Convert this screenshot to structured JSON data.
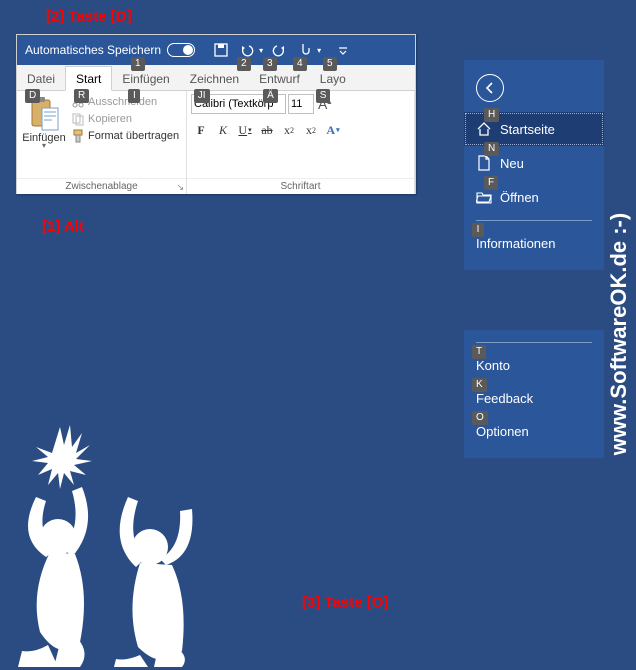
{
  "annotations": {
    "a1": "[1] Alt",
    "a2": "[2] Taste [D]",
    "a3": "[3] Taste [O]"
  },
  "titlebar": {
    "autosave": "Automatisches Speichern"
  },
  "qat_tips": {
    "q1": "1",
    "q2": "2",
    "q3": "3",
    "q4": "4",
    "q5": "5"
  },
  "tabs": {
    "file": "Datei",
    "start": "Start",
    "insert": "Einfügen",
    "draw": "Zeichnen",
    "design": "Entwurf",
    "layout": "Layo"
  },
  "tab_tips": {
    "file": "D",
    "start": "R",
    "insert": "I",
    "draw": "JI",
    "design": "Ä",
    "layout": "S"
  },
  "clipboard": {
    "paste": "Einfügen",
    "cut": "Ausschneiden",
    "copy": "Kopieren",
    "format": "Format übertragen",
    "group": "Zwischenablage"
  },
  "font": {
    "name": "Calibri (Textkörp",
    "size": "11",
    "group": "Schriftart",
    "aa_big": "A",
    "aa_small": "A",
    "b": "F",
    "i": "K",
    "u": "U",
    "ab": "ab",
    "x2": "x",
    "x2sub": "2",
    "x2b": "x",
    "x2sup": "2",
    "styleA": "A"
  },
  "backstage": {
    "home": "Startseite",
    "new": "Neu",
    "open": "Öffnen",
    "info": "Informationen",
    "account": "Konto",
    "feedback": "Feedback",
    "options": "Optionen"
  },
  "backstage_tips": {
    "home": "H",
    "new": "N",
    "open": "F",
    "info": "I",
    "account": "T",
    "feedback": "K",
    "options": "O"
  },
  "watermark": "www.SoftwareOK.de :-)"
}
